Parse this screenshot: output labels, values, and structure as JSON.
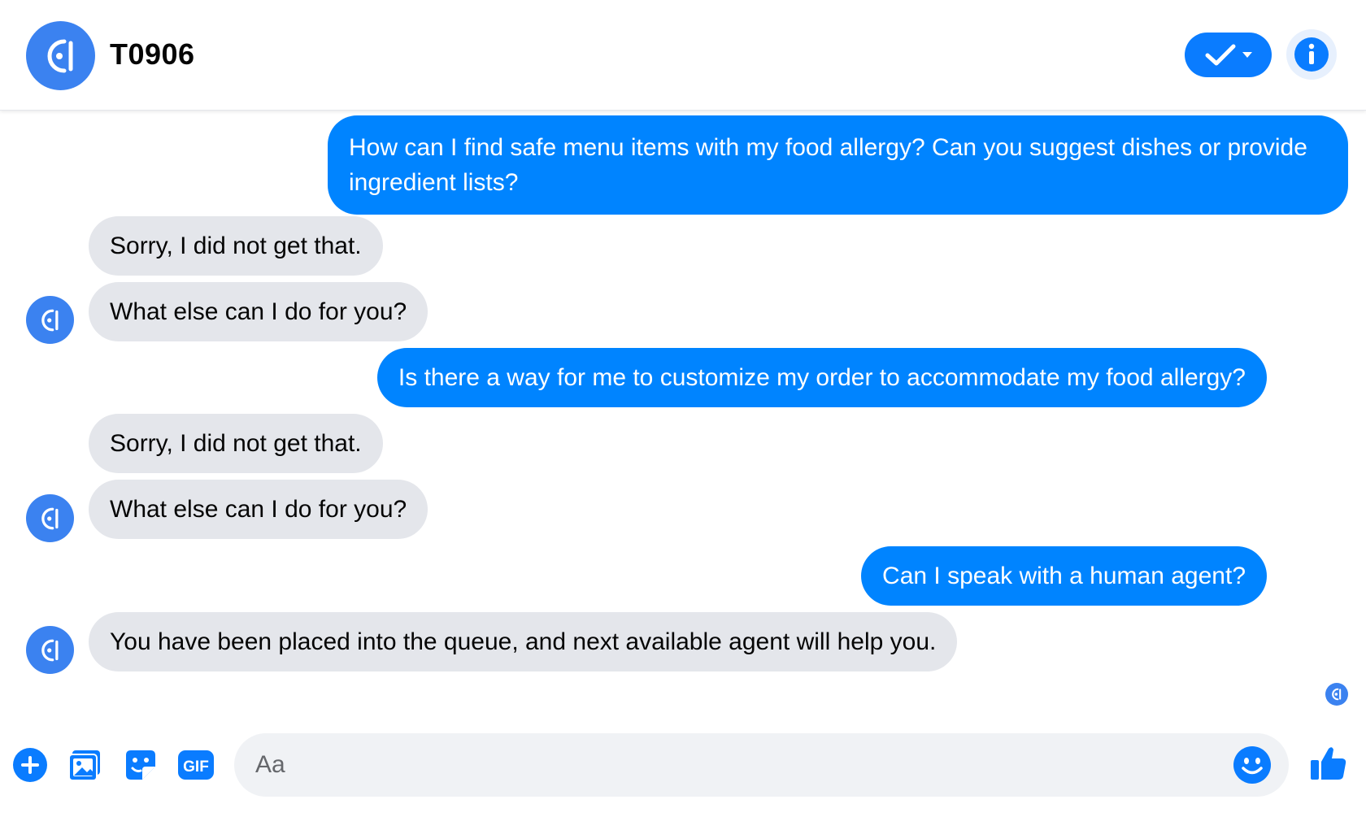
{
  "header": {
    "title": "T0906",
    "avatar_icon": "cl-logo-icon",
    "resolve_icon": "checkmark-dropdown-icon",
    "info_icon": "info-icon"
  },
  "messages": [
    {
      "sender": "user",
      "text": "How can I find safe menu items with my food allergy? Can you suggest dishes or provide ingredient lists?"
    },
    {
      "sender": "bot",
      "text": "Sorry, I did not get that."
    },
    {
      "sender": "bot",
      "text": "What else can I do for you?"
    },
    {
      "sender": "user",
      "text": "Is there a way for me to customize my order to accommodate my food allergy?"
    },
    {
      "sender": "bot",
      "text": "Sorry, I did not get that."
    },
    {
      "sender": "bot",
      "text": "What else can I do for you?"
    },
    {
      "sender": "user",
      "text": "Can I speak with a human agent?"
    },
    {
      "sender": "bot",
      "text": "You have been placed into the queue, and next available agent will help you."
    }
  ],
  "composer": {
    "placeholder": "Aa",
    "value": "",
    "gif_label": "GIF",
    "icons": [
      "plus-icon",
      "photo-icon",
      "sticker-icon",
      "gif-icon",
      "emoji-icon",
      "thumbs-up-icon"
    ]
  },
  "colors": {
    "accent": "#0084ff",
    "bot_bubble": "#e4e6eb",
    "avatar": "#3b82f0"
  }
}
